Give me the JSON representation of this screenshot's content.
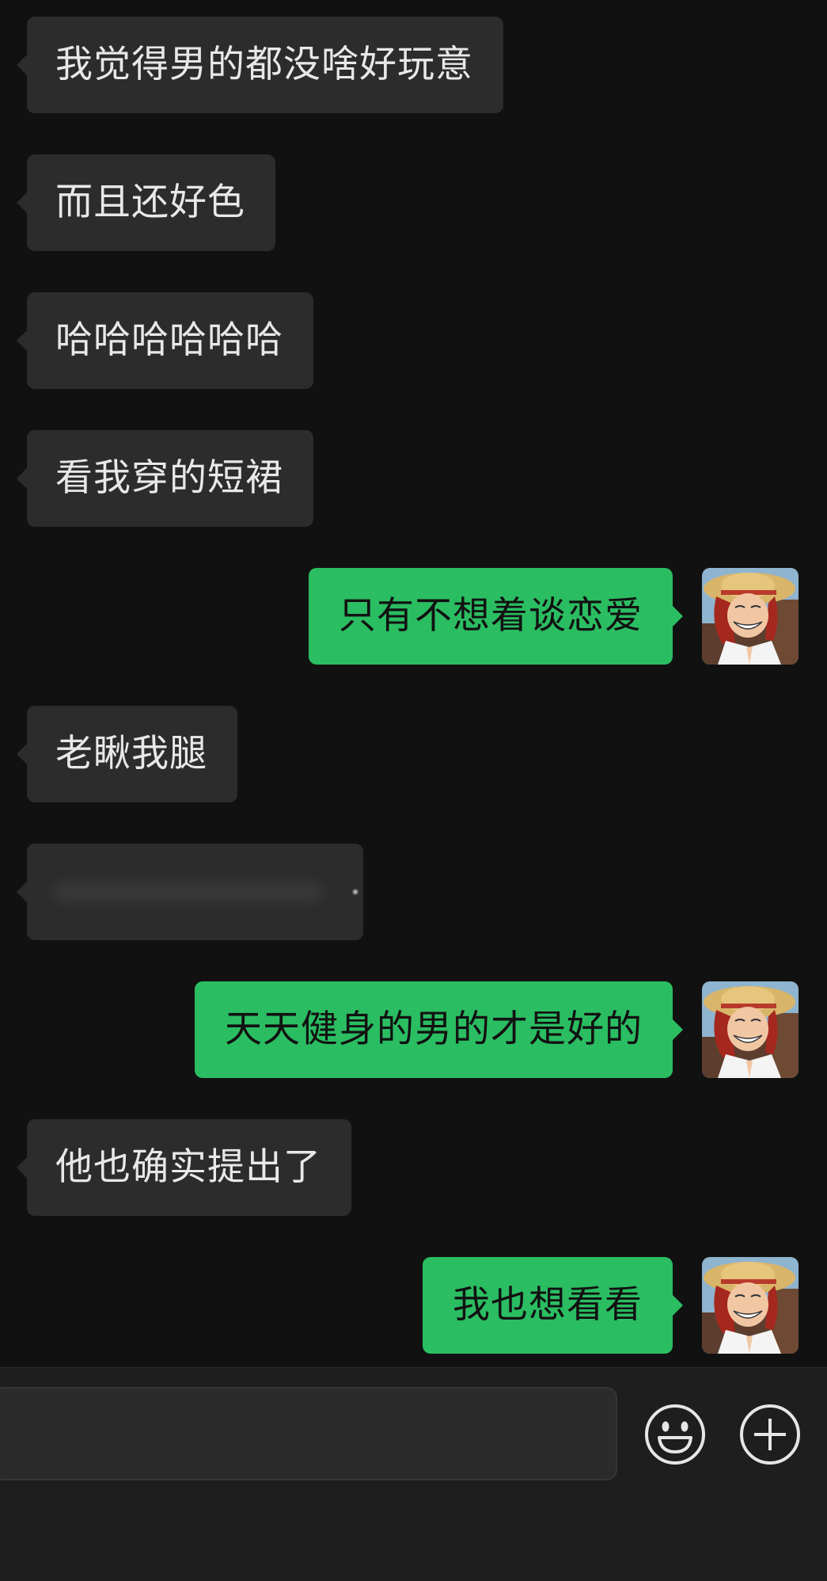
{
  "messages": [
    {
      "side": "left",
      "text": "我觉得男的都没啥好玩意"
    },
    {
      "side": "left",
      "text": "而且还好色"
    },
    {
      "side": "left",
      "text": "哈哈哈哈哈哈"
    },
    {
      "side": "left",
      "text": "看我穿的短裙"
    },
    {
      "side": "right",
      "text": "只有不想着谈恋爱"
    },
    {
      "side": "left",
      "text": "老瞅我腿"
    },
    {
      "side": "left",
      "text": ""
    },
    {
      "side": "right",
      "text": "天天健身的男的才是好的"
    },
    {
      "side": "left",
      "text": "他也确实提出了"
    },
    {
      "side": "right",
      "text": "我也想看看"
    }
  ],
  "input": {
    "value": "",
    "placeholder": ""
  },
  "icons": {
    "emoji": "smiley-face-icon",
    "more": "plus-circle-icon"
  },
  "colors": {
    "background": "#111111",
    "incoming_bubble": "#2c2c2c",
    "outgoing_bubble": "#2bbd62",
    "input_bar": "#1e1e1e"
  }
}
